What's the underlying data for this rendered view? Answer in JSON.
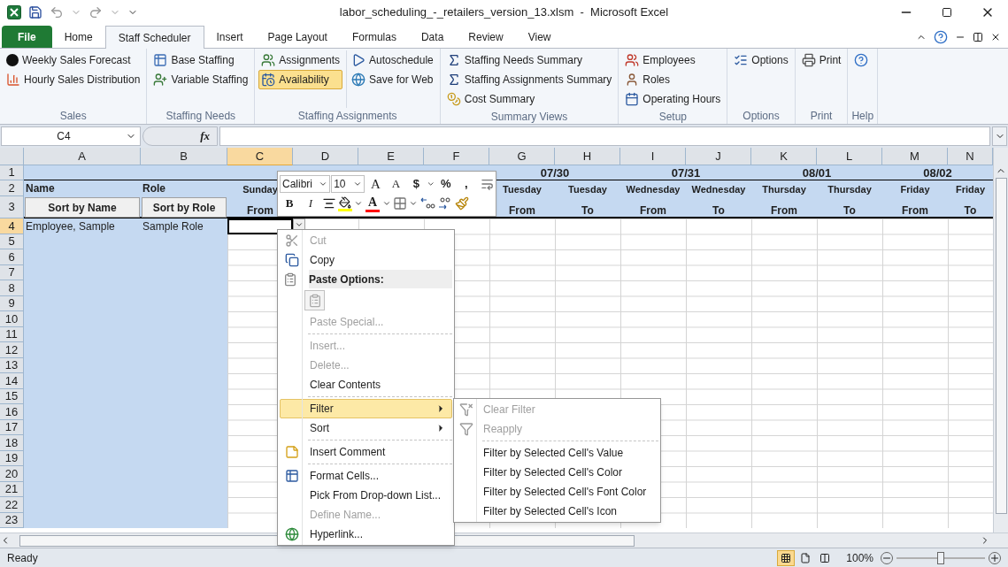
{
  "title_bar": {
    "title": "labor_scheduling_-_retailers_version_13.xlsm  -  Microsoft Excel"
  },
  "ribbon_tabs": [
    {
      "label": "File",
      "kind": "file",
      "selected": false
    },
    {
      "label": "Home",
      "kind": "tab",
      "selected": false
    },
    {
      "label": "Staff Scheduler",
      "kind": "tab",
      "selected": true
    },
    {
      "label": "Insert",
      "kind": "tab",
      "selected": false
    },
    {
      "label": "Page Layout",
      "kind": "tab",
      "selected": false
    },
    {
      "label": "Formulas",
      "kind": "tab",
      "selected": false
    },
    {
      "label": "Data",
      "kind": "tab",
      "selected": false
    },
    {
      "label": "Review",
      "kind": "tab",
      "selected": false
    },
    {
      "label": "View",
      "kind": "tab",
      "selected": false
    }
  ],
  "ribbon_groups": [
    {
      "label": "Sales",
      "columns": [
        [
          {
            "label": "Weekly Sales Forecast",
            "selected": false
          },
          {
            "label": "Hourly Sales Distribution",
            "selected": false
          }
        ]
      ]
    },
    {
      "label": "Staffing Needs",
      "columns": [
        [
          {
            "label": "Base Staffing",
            "selected": false
          },
          {
            "label": "Variable Staffing",
            "selected": false
          }
        ]
      ]
    },
    {
      "label": "Staffing Assignments",
      "columns": [
        [
          {
            "label": "Assignments",
            "selected": false
          },
          {
            "label": "Availability",
            "selected": true
          }
        ],
        [
          {
            "label": "Autoschedule",
            "selected": false
          },
          {
            "label": "Save for Web",
            "selected": false
          }
        ]
      ]
    },
    {
      "label": "Summary Views",
      "columns": [
        [
          {
            "label": "Staffing Needs Summary",
            "selected": false
          },
          {
            "label": "Staffing Assignments Summary",
            "selected": false
          },
          {
            "label": "Cost Summary",
            "selected": false
          }
        ]
      ]
    },
    {
      "label": "Setup",
      "columns": [
        [
          {
            "label": "Employees",
            "selected": false
          },
          {
            "label": "Roles",
            "selected": false
          },
          {
            "label": "Operating Hours",
            "selected": false
          }
        ]
      ]
    },
    {
      "label": "Options",
      "columns": [
        [
          {
            "label": "Options",
            "selected": false
          }
        ]
      ]
    },
    {
      "label": "Print",
      "columns": [
        [
          {
            "label": "Print",
            "selected": false
          }
        ]
      ]
    },
    {
      "label": "Help",
      "columns": [
        [
          {
            "selected": false
          }
        ]
      ]
    }
  ],
  "formula_bar": {
    "name_box": "C4",
    "function_label": "fx"
  },
  "sheet": {
    "columns": [
      {
        "label": "A",
        "selected": false
      },
      {
        "label": "B",
        "selected": false
      },
      {
        "label": "C",
        "selected": true
      },
      {
        "label": "D",
        "selected": false
      },
      {
        "label": "E",
        "selected": false
      },
      {
        "label": "F",
        "selected": false
      },
      {
        "label": "G",
        "selected": false
      },
      {
        "label": "H",
        "selected": false
      },
      {
        "label": "I",
        "selected": false
      },
      {
        "label": "J",
        "selected": false
      },
      {
        "label": "K",
        "selected": false
      },
      {
        "label": "L",
        "selected": false
      },
      {
        "label": "M",
        "selected": false
      },
      {
        "label": "N",
        "selected": false
      }
    ],
    "rows": [
      {
        "label": "1",
        "selected": false,
        "cells": [
          null,
          null,
          null,
          null,
          null,
          null,
          {
            "kind": "date",
            "text": "07/30"
          },
          null,
          {
            "kind": "date",
            "text": "07/31"
          },
          null,
          {
            "kind": "date",
            "text": "08/01"
          },
          null,
          {
            "kind": "date",
            "text": "08/02"
          }
        ]
      },
      {
        "label": "2",
        "selected": false,
        "cells": [
          {
            "kind": "title",
            "text": "Name"
          },
          {
            "kind": "title",
            "text": "Role"
          },
          {
            "kind": "day",
            "text": "Sunday"
          },
          null,
          null,
          null,
          {
            "kind": "day",
            "text": "Tuesday"
          },
          {
            "kind": "day",
            "text": "Tuesday"
          },
          {
            "kind": "day",
            "text": "Wednesday"
          },
          {
            "kind": "day",
            "text": "Wednesday"
          },
          {
            "kind": "day",
            "text": "Thursday"
          },
          {
            "kind": "day",
            "text": "Thursday"
          },
          {
            "kind": "day",
            "text": "Friday"
          },
          {
            "kind": "day",
            "text": "Friday"
          }
        ]
      },
      {
        "label": "3",
        "selected": false,
        "cells": [
          {
            "kind": "button",
            "text": "Sort by Name"
          },
          {
            "kind": "button",
            "text": "Sort by Role"
          },
          {
            "kind": "bound",
            "text": "From"
          },
          null,
          null,
          null,
          {
            "kind": "bound",
            "text": "From"
          },
          {
            "kind": "bound",
            "text": "To"
          },
          {
            "kind": "bound",
            "text": "From"
          },
          {
            "kind": "bound",
            "text": "To"
          },
          {
            "kind": "bound",
            "text": "From"
          },
          {
            "kind": "bound",
            "text": "To"
          },
          {
            "kind": "bound",
            "text": "From"
          },
          {
            "kind": "bound",
            "text": "To"
          }
        ]
      },
      {
        "label": "4",
        "selected": true,
        "cells": [
          {
            "kind": "value",
            "text": "Employee, Sample"
          },
          {
            "kind": "value",
            "text": "Sample Role"
          },
          {
            "kind": "active",
            "dropdown": true
          }
        ]
      },
      {
        "label": "5",
        "selected": false
      },
      {
        "label": "6",
        "selected": false
      },
      {
        "label": "7",
        "selected": false
      },
      {
        "label": "8",
        "selected": false
      },
      {
        "label": "9",
        "selected": false
      },
      {
        "label": "10",
        "selected": false
      },
      {
        "label": "11",
        "selected": false
      },
      {
        "label": "12",
        "selected": false
      },
      {
        "label": "13",
        "selected": false
      },
      {
        "label": "14",
        "selected": false
      },
      {
        "label": "15",
        "selected": false
      },
      {
        "label": "16",
        "selected": false
      },
      {
        "label": "17",
        "selected": false
      },
      {
        "label": "18",
        "selected": false
      },
      {
        "label": "19",
        "selected": false
      },
      {
        "label": "20",
        "selected": false
      },
      {
        "label": "21",
        "selected": false
      },
      {
        "label": "22",
        "selected": false
      },
      {
        "label": "23",
        "selected": false
      }
    ]
  },
  "mini_toolbar": {
    "font_name": "Calibri",
    "font_size": "10",
    "grow_font": "A",
    "shrink_font": "A",
    "currency": "$",
    "percent": "%",
    "comma": ",",
    "bold": "B",
    "italic": "I",
    "font_color": "A"
  },
  "context_menu": {
    "items": [
      {
        "kind": "item",
        "label": "Cut",
        "disabled": true,
        "selected": false,
        "submenu": false
      },
      {
        "kind": "item",
        "label": "Copy",
        "disabled": false,
        "selected": false,
        "submenu": false
      },
      {
        "kind": "header",
        "label": "Paste Options:"
      },
      {
        "kind": "paste-options"
      },
      {
        "kind": "item",
        "label": "Paste Special...",
        "disabled": true,
        "selected": false,
        "submenu": false
      },
      {
        "kind": "separator"
      },
      {
        "kind": "item",
        "label": "Insert...",
        "disabled": true,
        "selected": false,
        "submenu": false
      },
      {
        "kind": "item",
        "label": "Delete...",
        "disabled": true,
        "selected": false,
        "submenu": false
      },
      {
        "kind": "item",
        "label": "Clear Contents",
        "disabled": false,
        "selected": false,
        "submenu": false
      },
      {
        "kind": "separator"
      },
      {
        "kind": "item",
        "label": "Filter",
        "disabled": false,
        "selected": true,
        "submenu": true
      },
      {
        "kind": "item",
        "label": "Sort",
        "disabled": false,
        "selected": false,
        "submenu": true
      },
      {
        "kind": "separator"
      },
      {
        "kind": "item",
        "label": "Insert Comment",
        "disabled": false,
        "selected": false,
        "submenu": false
      },
      {
        "kind": "separator"
      },
      {
        "kind": "item",
        "label": "Format Cells...",
        "disabled": false,
        "selected": false,
        "submenu": false
      },
      {
        "kind": "item",
        "label": "Pick From Drop-down List...",
        "disabled": false,
        "selected": false,
        "submenu": false
      },
      {
        "kind": "item",
        "label": "Define Name...",
        "disabled": true,
        "selected": false,
        "submenu": false
      },
      {
        "kind": "item",
        "label": "Hyperlink...",
        "disabled": false,
        "selected": false,
        "submenu": false
      }
    ]
  },
  "submenu": {
    "items": [
      {
        "kind": "item",
        "label": "Clear Filter",
        "disabled": true
      },
      {
        "kind": "item",
        "label": "Reapply",
        "disabled": true
      },
      {
        "kind": "separator"
      },
      {
        "kind": "item",
        "label": "Filter by Selected Cell's Value",
        "disabled": false
      },
      {
        "kind": "item",
        "label": "Filter by Selected Cell's Color",
        "disabled": false
      },
      {
        "kind": "item",
        "label": "Filter by Selected Cell's Font Color",
        "disabled": false
      },
      {
        "kind": "item",
        "label": "Filter by Selected Cell's Icon",
        "disabled": false
      }
    ]
  },
  "status_bar": {
    "status": "Ready",
    "views": [
      {
        "kind": "normal",
        "selected": true
      },
      {
        "kind": "page-layout",
        "selected": false
      },
      {
        "kind": "page-break",
        "selected": false
      }
    ],
    "zoom": "100%",
    "zoom_slider": {
      "level": 0.5
    }
  }
}
